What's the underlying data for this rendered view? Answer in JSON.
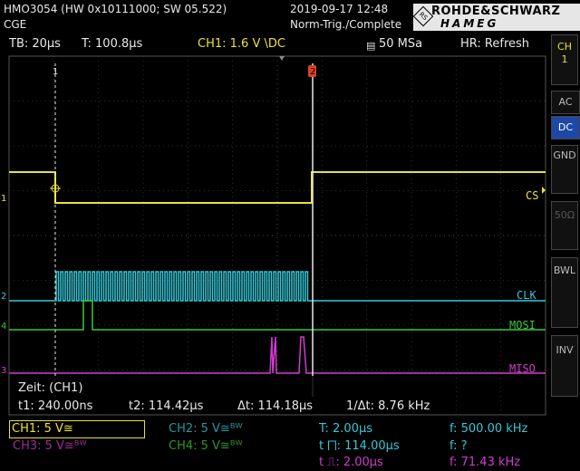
{
  "header": {
    "device": "HMO3054 (HW 0x10111000; SW 05.522)",
    "sub": "CGE",
    "datetime": "2019-09-17 12:48",
    "trig_status": "Norm-Trig./Complete",
    "brand_top": "ROHDE&SCHWARZ",
    "brand_bottom": "HAMEG",
    "brand_seal": "RS"
  },
  "status": {
    "timebase": "TB: 20µs",
    "trigger_pos": "T: 100.8µs",
    "trigger_src": "CH1: 1.6 V \\DC",
    "sample_rate": "50 MSa",
    "hr": "HR: Refresh"
  },
  "colors": {
    "ch1": "#e8e23a",
    "ch2": "#35c8d8",
    "ch3": "#d23ad2",
    "ch4": "#3ac83a",
    "grid": "#3a3a3a",
    "cursor": "#e8e8e8",
    "trigger_marker": "#e04020"
  },
  "screen": {
    "ch1_label": "CS",
    "ch2_label": "CLK",
    "ch4_label": "MOSI",
    "ch3_label": "MISO",
    "marker1": "1",
    "marker2": "2",
    "ch_ids": [
      "1",
      "2",
      "4",
      "3"
    ]
  },
  "cursor_panel": {
    "title": "Zeit: (CH1)",
    "t1": "t1: 240.00ns",
    "t2": "t2: 114.42µs",
    "dt": "Δt: 114.18µs",
    "inv_dt": "1/Δt: 8.76 kHz"
  },
  "side": {
    "ch": "CH\n1",
    "buttons": [
      "AC",
      "DC",
      "GND",
      "50Ω",
      "BWL",
      "INV"
    ],
    "selected": "DC"
  },
  "bottom": {
    "ch1": "CH1: 5 V≅",
    "ch2": "CH2: 5 V≅ᴮᵂ",
    "ch3": "CH3: 5 V≅ᴮᵂ",
    "ch4": "CH4: 5 V≅ᴮᵂ",
    "T": "T: 2.00µs",
    "t_high": "t ⨅: 114.00µs",
    "t_low": "t ⎍: 2.00µs",
    "f1": "f: 500.00 kHz",
    "f2": "f: ?",
    "f3": "f: 71.43 kHz"
  }
}
